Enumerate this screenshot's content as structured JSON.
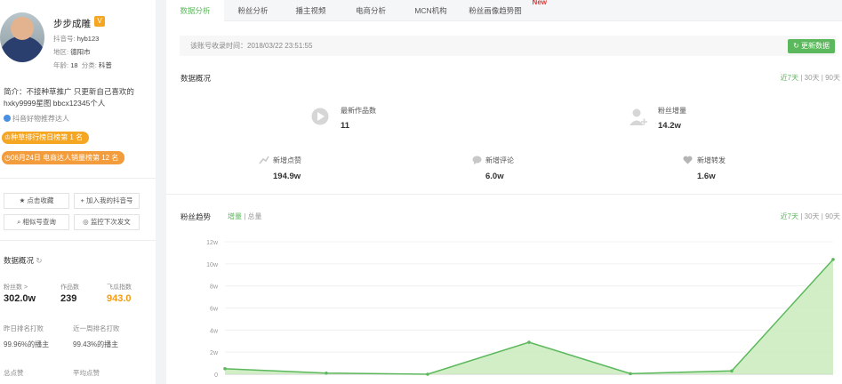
{
  "profile": {
    "name": "步步成雕",
    "badge": "V",
    "douyin_id_label": "抖音号:",
    "douyin_id": "hyb123",
    "region_label": "地区:",
    "region": "德阳市",
    "age_label": "年龄:",
    "age": "18",
    "category_label": "分类:",
    "category": "科普",
    "intro": "简介：不接种草推广 只更新自己喜欢的hxky9999星图 bbcx12345个人",
    "recommend": "抖音好物推荐达人",
    "rank1": "种草排行榜日榜第 1 名",
    "rank2": "06月24日 电商达人销量榜第 12 名"
  },
  "actions": {
    "favorite": "点击收藏",
    "add_to_my": "加入我的抖音号",
    "similar_query": "相似号查询",
    "monitor": "监控下次发文"
  },
  "left_stats": {
    "title": "数据概况",
    "fans_label": "粉丝数 >",
    "fans_value": "302.0w",
    "works_label": "作品数",
    "works_value": "239",
    "index_label": "飞瓜指数",
    "index_value": "943.0",
    "yesterday_label": "昨日排名打败",
    "yesterday_value": "99.96%的播主",
    "week_label": "近一周排名打败",
    "week_value": "99.43%的播主",
    "total_likes_label": "总点赞",
    "avg_likes_label": "平均点赞"
  },
  "tabs": [
    "数据分析",
    "粉丝分析",
    "播主视频",
    "电商分析",
    "MCN机构",
    "粉丝画像趋势图"
  ],
  "new_tag": "New",
  "collect_time": "该账号收录时间：2018/03/22 23:51:55",
  "refresh_label": "更新数据",
  "overview": {
    "title": "数据概况",
    "range": [
      "近7天",
      "30天",
      "90天"
    ],
    "new_works_label": "最新作品数",
    "new_works_value": "11",
    "fans_growth_label": "粉丝增量",
    "fans_growth_value": "14.2w",
    "new_likes_label": "新增点赞",
    "new_likes_value": "194.9w",
    "new_comments_label": "新增评论",
    "new_comments_value": "6.0w",
    "new_shares_label": "新增转发",
    "new_shares_value": "1.6w"
  },
  "trend": {
    "title": "粉丝趋势",
    "mode_on": "增量",
    "mode_off": "总量",
    "range": [
      "近7天",
      "30天",
      "90天"
    ]
  },
  "colors": {
    "accent": "#5cb85c",
    "orange": "#f39c12",
    "badge": "#f5a623"
  },
  "chart_data": {
    "type": "area",
    "yticks": [
      "12w",
      "10w",
      "8w",
      "6w",
      "4w",
      "2w",
      "0"
    ],
    "ylim": [
      0,
      12
    ],
    "x": [
      0,
      1,
      2,
      3,
      4,
      5,
      6
    ],
    "values": [
      0.5,
      0.1,
      0.0,
      2.9,
      0.05,
      0.3,
      10.4
    ],
    "xlabel": "",
    "ylabel": ""
  }
}
